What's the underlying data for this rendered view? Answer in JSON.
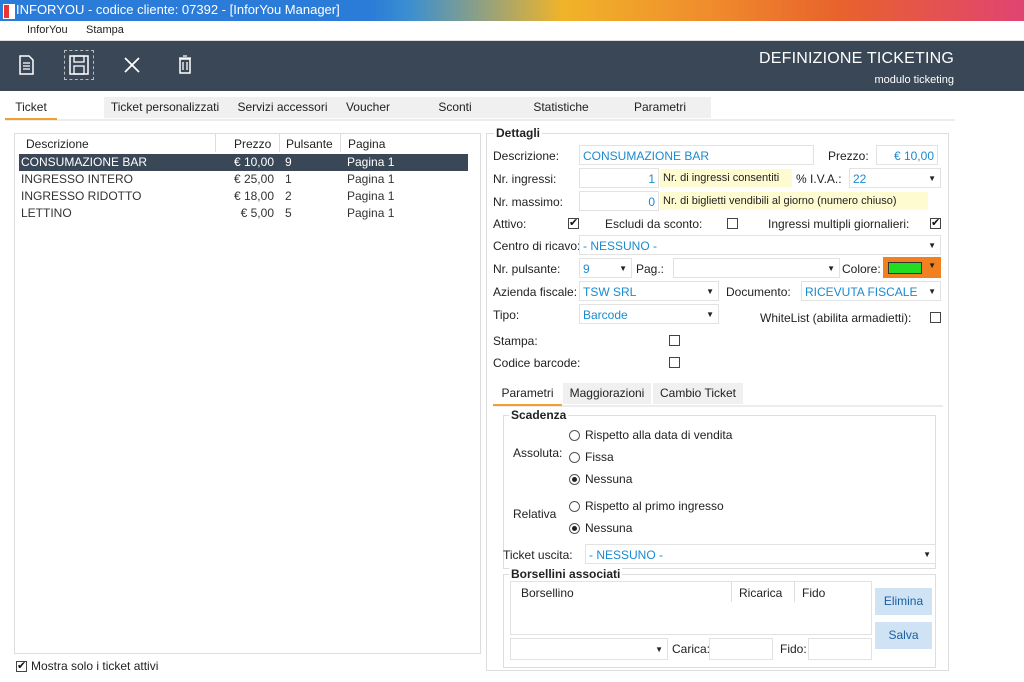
{
  "window": {
    "title": "INFORYOU - codice cliente:  07392 - [InforYou Manager]"
  },
  "menu": {
    "items": [
      "InforYou",
      "Stampa"
    ]
  },
  "header": {
    "title": "DEFINIZIONE TICKETING",
    "subtitle": "modulo ticketing"
  },
  "tabs": [
    "Ticket",
    "Ticket personalizzati",
    "Servizi accessori",
    "Voucher",
    "Sconti",
    "Statistiche",
    "Parametri"
  ],
  "active_tab": "Ticket",
  "table": {
    "columns": [
      "Descrizione",
      "Prezzo",
      "Pulsante",
      "Pagina"
    ],
    "rows": [
      {
        "descrizione": "CONSUMAZIONE BAR",
        "prezzo": "€ 10,00",
        "pulsante": "9",
        "pagina": "Pagina 1",
        "selected": true
      },
      {
        "descrizione": "INGRESSO INTERO",
        "prezzo": "€ 25,00",
        "pulsante": "1",
        "pagina": "Pagina 1"
      },
      {
        "descrizione": "INGRESSO RIDOTTO",
        "prezzo": "€ 18,00",
        "pulsante": "2",
        "pagina": "Pagina 1"
      },
      {
        "descrizione": "LETTINO",
        "prezzo": "€ 5,00",
        "pulsante": "5",
        "pagina": "Pagina 1"
      }
    ]
  },
  "show_active_only": {
    "label": "Mostra solo i ticket attivi",
    "checked": true
  },
  "dettagli": {
    "title": "Dettagli",
    "descrizione_label": "Descrizione:",
    "descrizione": "CONSUMAZIONE BAR",
    "prezzo_label": "Prezzo:",
    "prezzo": "€ 10,00",
    "nr_ingressi_label": "Nr. ingressi:",
    "nr_ingressi": "1",
    "nr_ingressi_hint": "Nr. di ingressi consentiti",
    "iva_label": "% I.V.A.:",
    "iva": "22",
    "nr_massimo_label": "Nr. massimo:",
    "nr_massimo": "0",
    "nr_massimo_hint": "Nr. di biglietti vendibili al giorno (numero chiuso)",
    "attivo_label": "Attivo:",
    "attivo": true,
    "escludi_label": "Escludi da sconto:",
    "escludi": false,
    "multipli_label": "Ingressi multipli giornalieri:",
    "multipli": true,
    "centro_label": "Centro di ricavo:",
    "centro": "- NESSUNO -",
    "pulsante_label": "Nr. pulsante:",
    "pulsante": "9",
    "pag_label": "Pag.:",
    "pag": "",
    "colore_label": "Colore:",
    "colore": "#22dd22",
    "azienda_label": "Azienda fiscale:",
    "azienda": "TSW SRL",
    "documento_label": "Documento:",
    "documento": "RICEVUTA FISCALE",
    "tipo_label": "Tipo:",
    "tipo": "Barcode",
    "whitelist_label": "WhiteList (abilita armadietti):",
    "whitelist": false,
    "stampa_label": "Stampa:",
    "stampa": false,
    "codice_label": "Codice barcode:",
    "codice": false
  },
  "subtabs": [
    "Parametri",
    "Maggiorazioni",
    "Cambio Ticket"
  ],
  "scadenza": {
    "title": "Scadenza",
    "assoluta_label": "Assoluta:",
    "assoluta_options": [
      "Rispetto alla data di vendita",
      "Fissa",
      "Nessuna"
    ],
    "assoluta_selected": "Nessuna",
    "relativa_label": "Relativa",
    "relativa_options": [
      "Rispetto al primo ingresso",
      "Nessuna"
    ],
    "relativa_selected": "Nessuna"
  },
  "ticket_uscita": {
    "label": "Ticket uscita:",
    "value": "- NESSUNO -"
  },
  "borsellini": {
    "title": "Borsellini associati",
    "columns": [
      "Borsellino",
      "Ricarica",
      "Fido"
    ],
    "carica_label": "Carica:",
    "fido_label": "Fido:",
    "elimina": "Elimina",
    "salva": "Salva"
  },
  "colors": {
    "toolbar": "#3a4756",
    "accent": "#f0a030",
    "value": "#1a8ad0"
  }
}
